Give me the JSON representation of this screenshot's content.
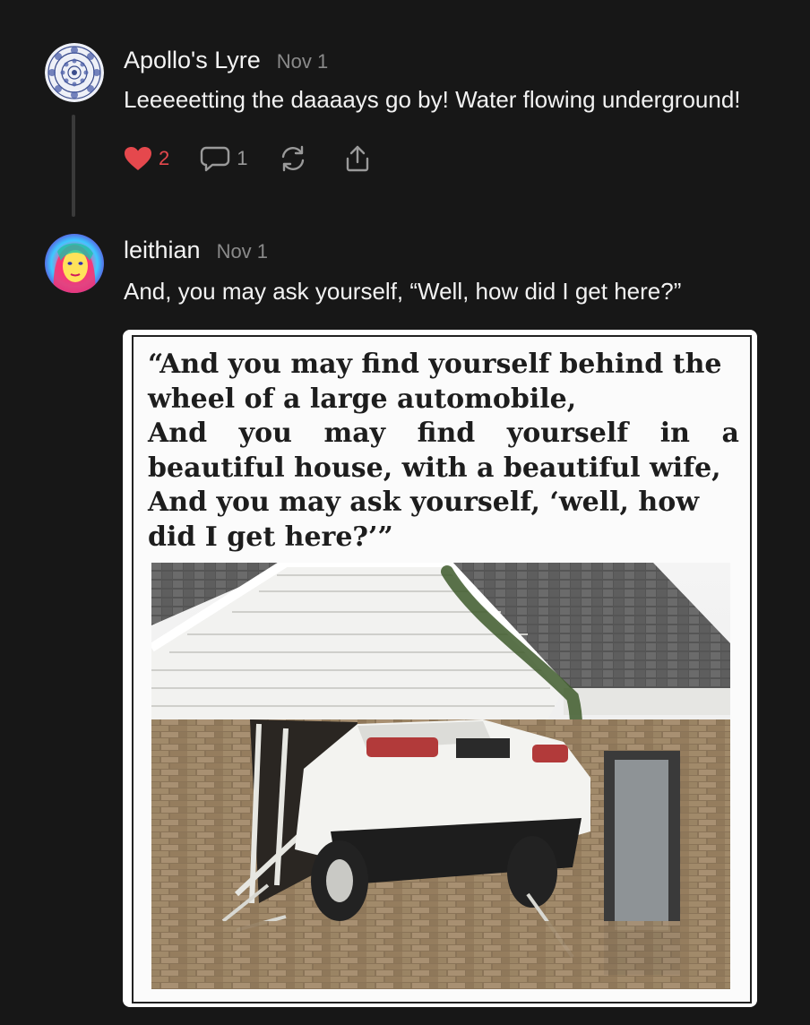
{
  "comments": [
    {
      "author": "Apollo's Lyre",
      "date": "Nov 1",
      "text": "Leeeeetting the daaaays go by! Water flowing underground!",
      "likes": "2",
      "replies": "1",
      "avatar_icon": "mandala-icon"
    },
    {
      "author": "leithian",
      "date": "Nov 1",
      "text": "And, you may ask yourself, “Well, how did I get here?”",
      "avatar_icon": "portrait-avatar",
      "image": {
        "quote_lines": [
          "“And you may find yourself behind the",
          "wheel of a large automobile,",
          [
            "And",
            "you",
            "may",
            "find",
            "yourself",
            "in",
            "a"
          ],
          "beautiful house, with a beautiful wife,",
          "And you may ask yourself, ‘well, how",
          "did I get here?’”"
        ],
        "photo": "car-crashed-into-house"
      }
    }
  ],
  "colors": {
    "background": "#171717",
    "like": "#e5484d",
    "muted": "#8a8a8a"
  }
}
